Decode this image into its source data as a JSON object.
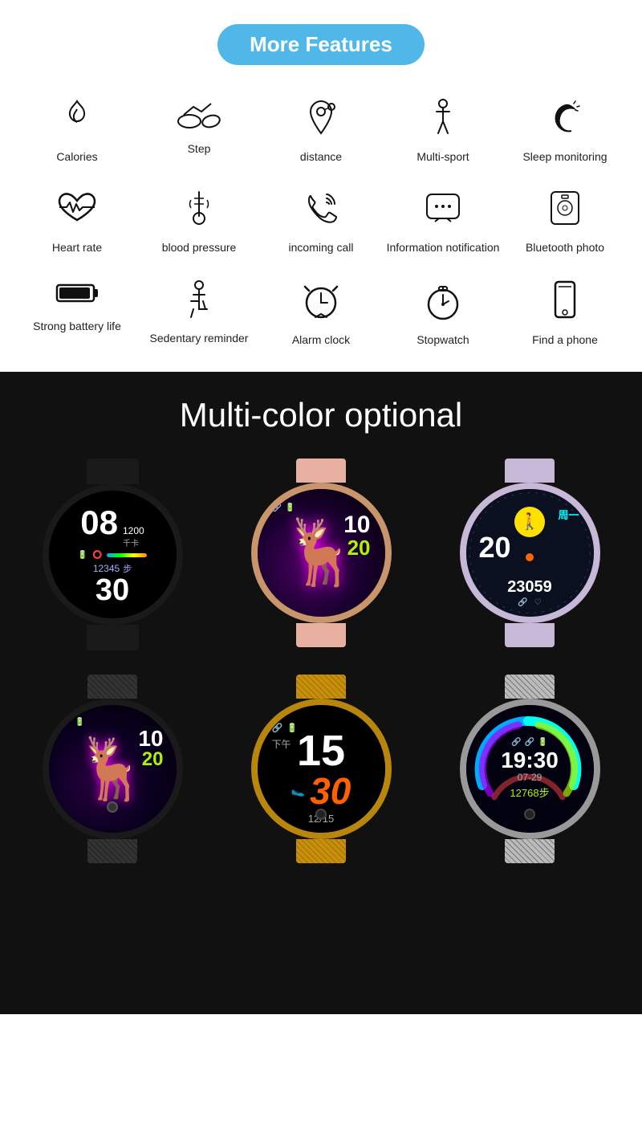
{
  "header": {
    "badge": "More Features"
  },
  "features": [
    {
      "id": "calories",
      "icon": "🔥",
      "label": "Calories"
    },
    {
      "id": "step",
      "icon": "👟",
      "label": "Step"
    },
    {
      "id": "distance",
      "icon": "📍",
      "label": "distance"
    },
    {
      "id": "multisport",
      "icon": "🚶",
      "label": "Multi-sport"
    },
    {
      "id": "sleep",
      "icon": "🌙",
      "label": "Sleep monitoring"
    },
    {
      "id": "heartrate",
      "icon": "💓",
      "label": "Heart rate"
    },
    {
      "id": "bloodpressure",
      "icon": "🌡️",
      "label": "blood pressure"
    },
    {
      "id": "incomingcall",
      "icon": "📞",
      "label": "incoming call"
    },
    {
      "id": "infonotify",
      "icon": "💬",
      "label": "Information notification"
    },
    {
      "id": "bluetooth",
      "icon": "📷",
      "label": "Bluetooth photo"
    },
    {
      "id": "battery",
      "icon": "🔋",
      "label": "Strong battery life"
    },
    {
      "id": "sedentary",
      "icon": "🪑",
      "label": "Sedentary reminder"
    },
    {
      "id": "alarm",
      "icon": "⏰",
      "label": "Alarm clock"
    },
    {
      "id": "stopwatch",
      "icon": "⏱️",
      "label": "Stopwatch"
    },
    {
      "id": "findphone",
      "icon": "📱",
      "label": "Find a phone"
    }
  ],
  "colors_section": {
    "title": "Multi-color optional"
  },
  "watches": [
    {
      "id": "black-silicone",
      "style": "watch-black",
      "screen": "screen-1"
    },
    {
      "id": "pink-silicone",
      "style": "watch-pink",
      "screen": "screen-2"
    },
    {
      "id": "purple-silicone",
      "style": "watch-purple",
      "screen": "screen-3"
    },
    {
      "id": "black-mesh",
      "style": "watch-black-mesh",
      "screen": "screen-4"
    },
    {
      "id": "gold-mesh",
      "style": "watch-gold-mesh",
      "screen": "screen-5"
    },
    {
      "id": "silver-mesh",
      "style": "watch-silver-mesh",
      "screen": "screen-6"
    }
  ]
}
